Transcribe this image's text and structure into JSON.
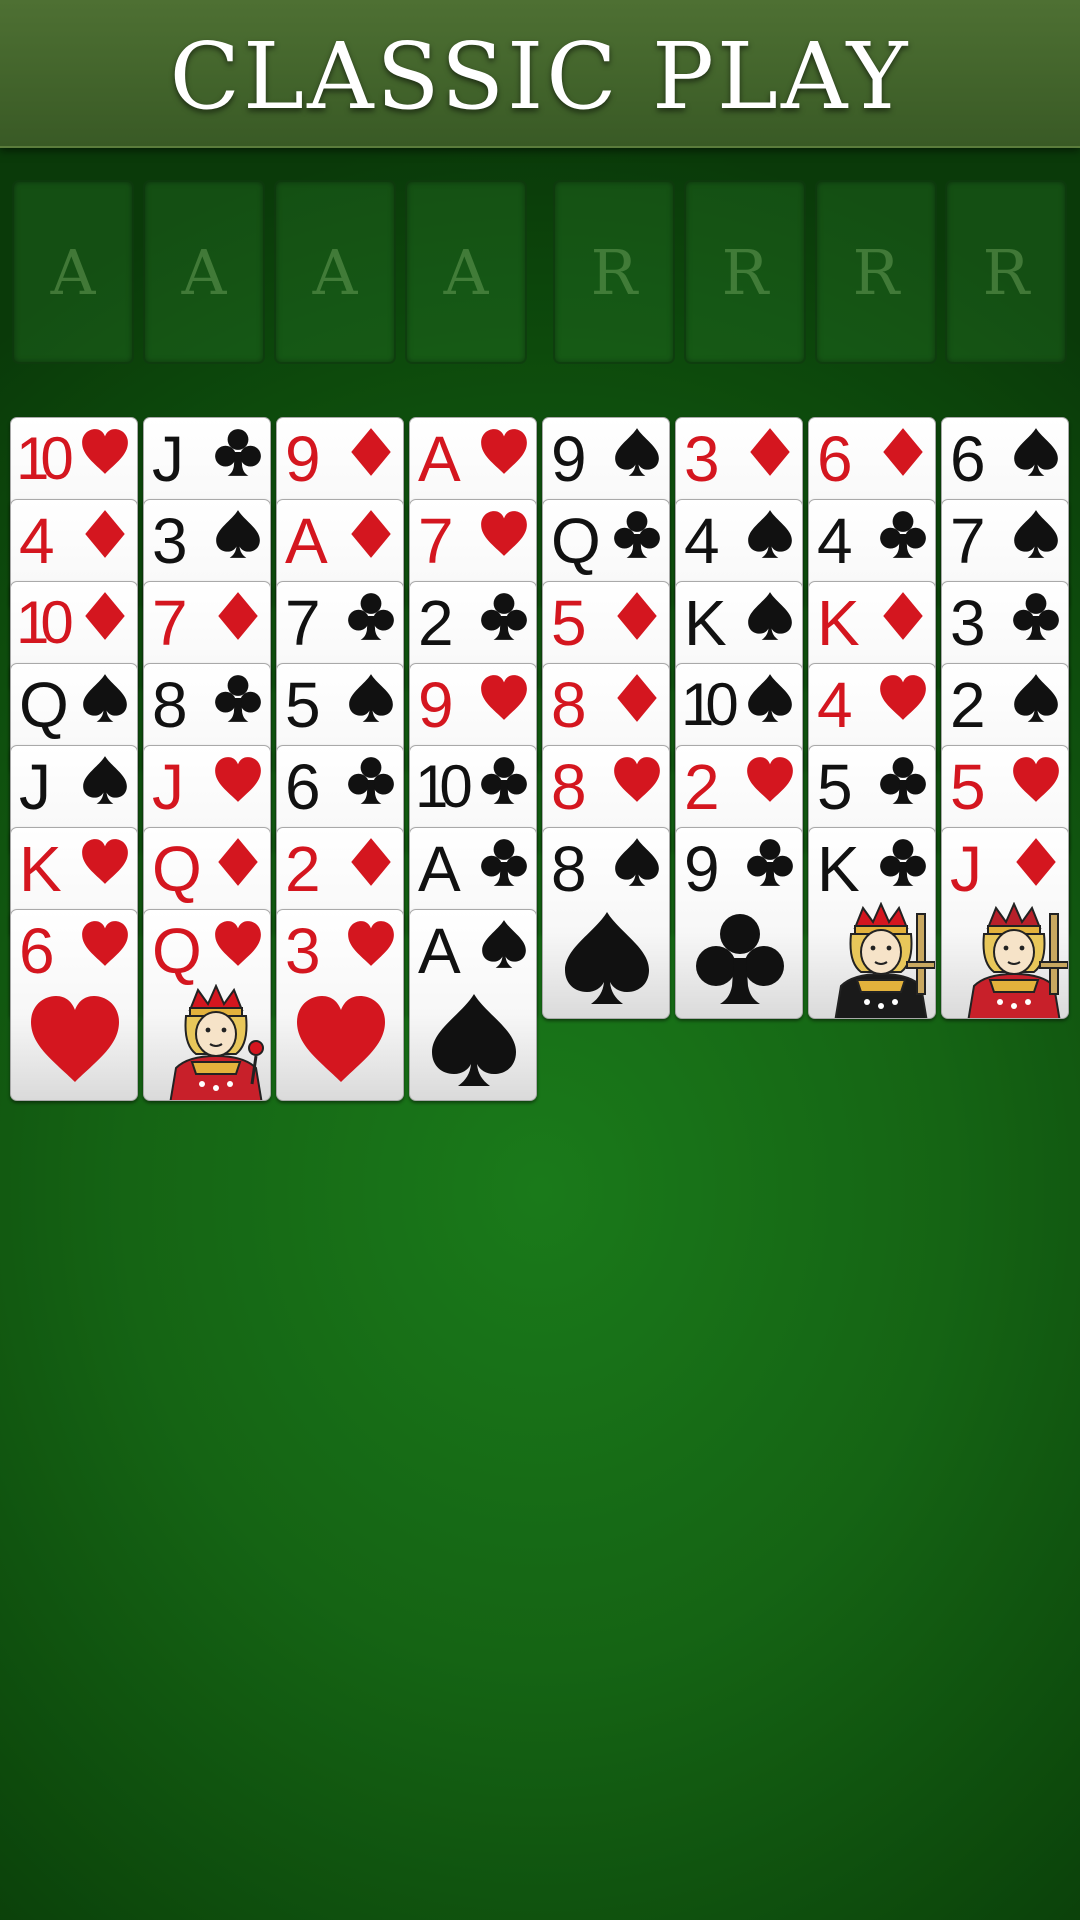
{
  "header": {
    "title": "CLASSIC PLAY"
  },
  "foundations": [
    {
      "label": "A"
    },
    {
      "label": "A"
    },
    {
      "label": "A"
    },
    {
      "label": "A"
    }
  ],
  "freecells": [
    {
      "label": "R"
    },
    {
      "label": "R"
    },
    {
      "label": "R"
    },
    {
      "label": "R"
    }
  ],
  "tableau": [
    [
      {
        "rank": "10",
        "suit": "hearts"
      },
      {
        "rank": "4",
        "suit": "diamonds"
      },
      {
        "rank": "10",
        "suit": "diamonds"
      },
      {
        "rank": "Q",
        "suit": "spades"
      },
      {
        "rank": "J",
        "suit": "spades"
      },
      {
        "rank": "K",
        "suit": "hearts"
      },
      {
        "rank": "6",
        "suit": "hearts"
      }
    ],
    [
      {
        "rank": "J",
        "suit": "clubs"
      },
      {
        "rank": "3",
        "suit": "spades"
      },
      {
        "rank": "7",
        "suit": "diamonds"
      },
      {
        "rank": "8",
        "suit": "clubs"
      },
      {
        "rank": "J",
        "suit": "hearts"
      },
      {
        "rank": "Q",
        "suit": "diamonds"
      },
      {
        "rank": "Q",
        "suit": "hearts"
      }
    ],
    [
      {
        "rank": "9",
        "suit": "diamonds"
      },
      {
        "rank": "A",
        "suit": "diamonds"
      },
      {
        "rank": "7",
        "suit": "clubs"
      },
      {
        "rank": "5",
        "suit": "spades"
      },
      {
        "rank": "6",
        "suit": "clubs"
      },
      {
        "rank": "2",
        "suit": "diamonds"
      },
      {
        "rank": "3",
        "suit": "hearts"
      }
    ],
    [
      {
        "rank": "A",
        "suit": "hearts"
      },
      {
        "rank": "7",
        "suit": "hearts"
      },
      {
        "rank": "2",
        "suit": "clubs"
      },
      {
        "rank": "9",
        "suit": "hearts"
      },
      {
        "rank": "10",
        "suit": "clubs"
      },
      {
        "rank": "A",
        "suit": "clubs"
      },
      {
        "rank": "A",
        "suit": "spades"
      }
    ],
    [
      {
        "rank": "9",
        "suit": "spades"
      },
      {
        "rank": "Q",
        "suit": "clubs"
      },
      {
        "rank": "5",
        "suit": "diamonds"
      },
      {
        "rank": "8",
        "suit": "diamonds"
      },
      {
        "rank": "8",
        "suit": "hearts"
      },
      {
        "rank": "8",
        "suit": "spades"
      }
    ],
    [
      {
        "rank": "3",
        "suit": "diamonds"
      },
      {
        "rank": "4",
        "suit": "spades"
      },
      {
        "rank": "K",
        "suit": "spades"
      },
      {
        "rank": "10",
        "suit": "spades"
      },
      {
        "rank": "2",
        "suit": "hearts"
      },
      {
        "rank": "9",
        "suit": "clubs"
      }
    ],
    [
      {
        "rank": "6",
        "suit": "diamonds"
      },
      {
        "rank": "4",
        "suit": "clubs"
      },
      {
        "rank": "K",
        "suit": "diamonds"
      },
      {
        "rank": "4",
        "suit": "hearts"
      },
      {
        "rank": "5",
        "suit": "clubs"
      },
      {
        "rank": "K",
        "suit": "clubs"
      }
    ],
    [
      {
        "rank": "6",
        "suit": "spades"
      },
      {
        "rank": "7",
        "suit": "spades"
      },
      {
        "rank": "3",
        "suit": "clubs"
      },
      {
        "rank": "2",
        "suit": "spades"
      },
      {
        "rank": "5",
        "suit": "hearts"
      },
      {
        "rank": "J",
        "suit": "diamonds"
      }
    ]
  ],
  "colors": {
    "felt": "#156414",
    "header": "#42642b",
    "red_suit": "#d4161f",
    "black_suit": "#111111"
  }
}
